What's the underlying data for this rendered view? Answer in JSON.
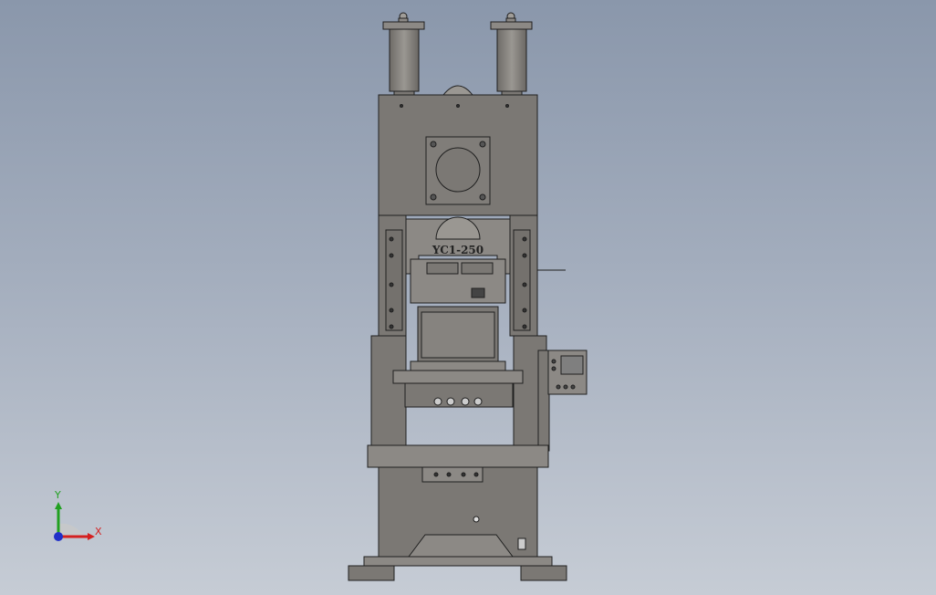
{
  "model": {
    "label": "YC1-250"
  },
  "triad": {
    "x_label": "X",
    "y_label": "Y",
    "x_color": "#d42020",
    "y_color": "#20a020",
    "z_color": "#2030c8"
  },
  "colors": {
    "background_top": "#8a97ab",
    "background_bottom": "#c6ccd5",
    "body": "#7b7874",
    "body_light": "#8c8985",
    "outline": "#1f1f1f"
  }
}
